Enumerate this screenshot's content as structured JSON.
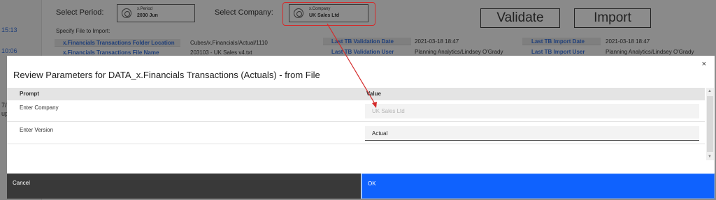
{
  "background": {
    "times": [
      "15:13",
      "10:06",
      "7/",
      "up"
    ],
    "select_period": {
      "label": "Select Period:",
      "dimension": "x.Period",
      "value": "2030 Jun"
    },
    "select_company": {
      "label": "Select Company:",
      "dimension": "x.Company",
      "value": "UK Sales Ltd"
    },
    "validate_label": "Validate",
    "import_label": "Import",
    "specify_file_label": "Specify File to Import:",
    "folder_location_label": "x.Financials Transactions Folder Location",
    "folder_location_value": "Cubes/x.Financials/Actual/1110",
    "file_name_label": "x.Financials Transactions File Name",
    "file_name_value": "203103 - UK Sales v4.txt",
    "validation": {
      "date_label": "Last TB Validation Date",
      "date_value": "2021-03-18 18:47",
      "user_label": "Last TB Validation User",
      "user_value": "Planning Analytics/Lindsey O'Grady"
    },
    "import_info": {
      "date_label": "Last TB Import Date",
      "date_value": "2021-03-18 18:47",
      "user_label": "Last TB Import User",
      "user_value": "Planning Analytics/Lindsey O'Grady"
    },
    "highlight_color": "#d42a2a"
  },
  "dialog": {
    "title": "Review Parameters for DATA_x.Financials Transactions (Actuals) - from File",
    "close_icon": "×",
    "columns": {
      "prompt": "Prompt",
      "value": "Value"
    },
    "rows": [
      {
        "prompt": "Enter Company",
        "value": "UK Sales Ltd",
        "disabled": true
      },
      {
        "prompt": "Enter Version",
        "value": "Actual",
        "disabled": false
      }
    ],
    "cancel_label": "Cancel",
    "ok_label": "OK",
    "ok_color": "#0f62fe",
    "cancel_color": "#393939"
  }
}
